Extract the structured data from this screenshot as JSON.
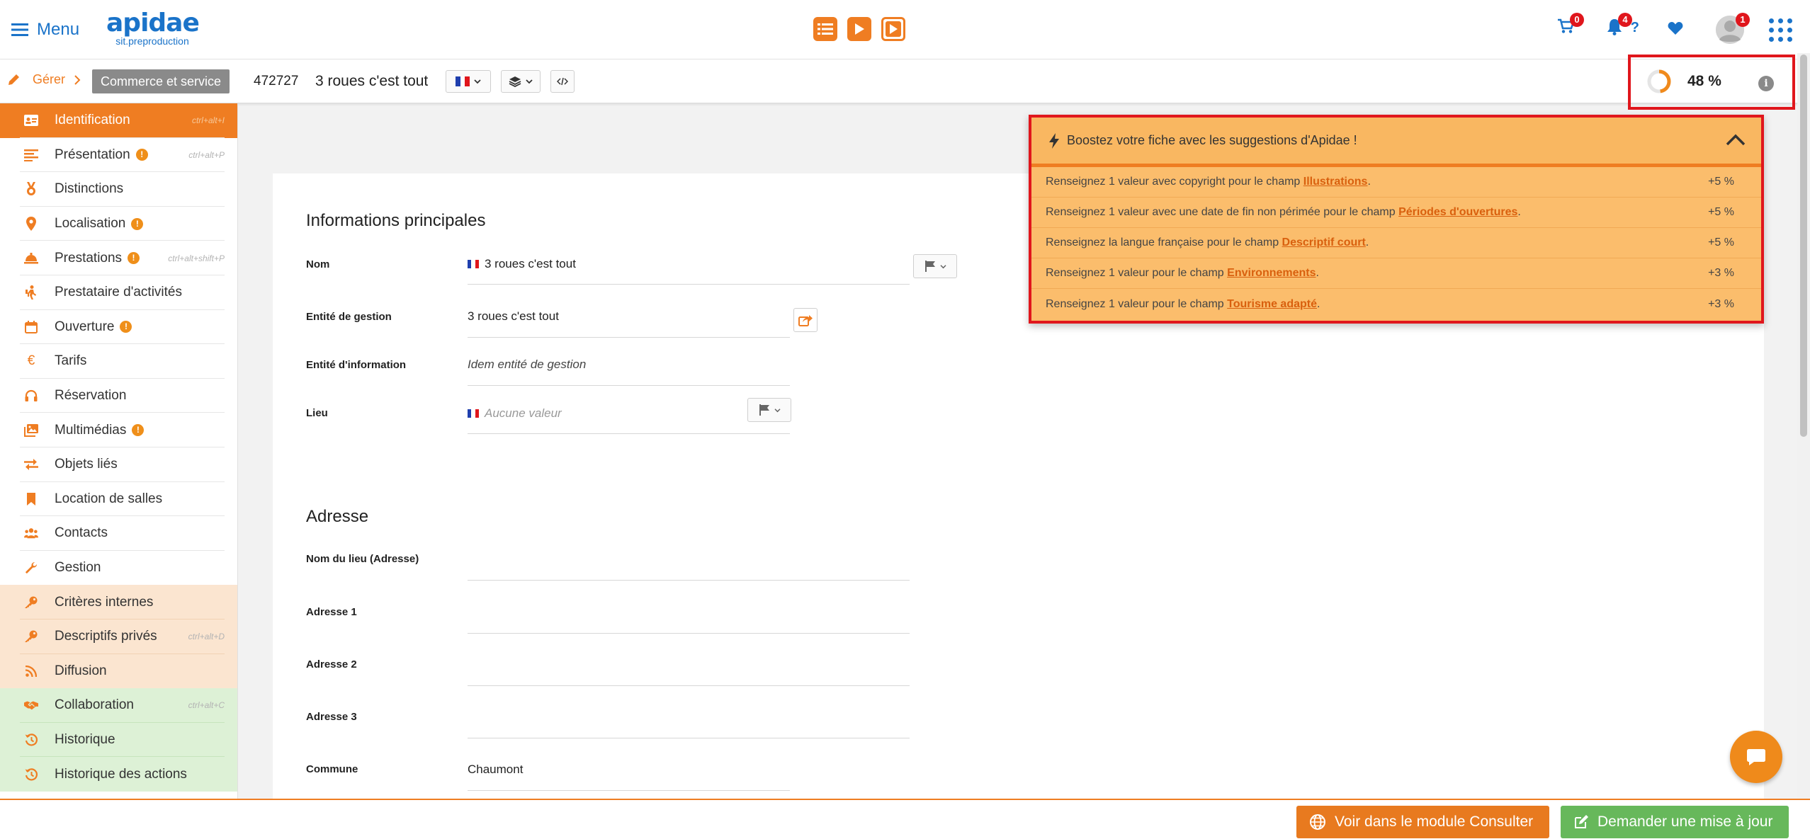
{
  "topbar": {
    "menu_label": "Menu",
    "logo_main": "apidae",
    "logo_sub": "sit.preproduction",
    "cart_count": "0",
    "notif_count": "4",
    "help_label": "?",
    "avatar_count": "1"
  },
  "breadcrumb": {
    "manage_label": "Gérer",
    "category": "Commerce et service",
    "object_id": "472727",
    "object_name": "3 roues c'est tout"
  },
  "score": {
    "value": 48,
    "label": "48 %"
  },
  "sidebar": {
    "items": [
      {
        "label": "Identification",
        "shortcut": "ctrl+alt+I"
      },
      {
        "label": "Présentation",
        "shortcut": "ctrl+alt+P",
        "warn": "!"
      },
      {
        "label": "Distinctions"
      },
      {
        "label": "Localisation",
        "warn": "!"
      },
      {
        "label": "Prestations",
        "shortcut": "ctrl+alt+shift+P",
        "warn": "!"
      },
      {
        "label": "Prestataire d'activités"
      },
      {
        "label": "Ouverture",
        "warn": "!"
      },
      {
        "label": "Tarifs"
      },
      {
        "label": "Réservation"
      },
      {
        "label": "Multimédias",
        "warn": "!"
      },
      {
        "label": "Objets liés"
      },
      {
        "label": "Location de salles"
      },
      {
        "label": "Contacts"
      },
      {
        "label": "Gestion"
      },
      {
        "label": "Critères internes"
      },
      {
        "label": "Descriptifs privés",
        "shortcut": "ctrl+alt+D"
      },
      {
        "label": "Diffusion"
      },
      {
        "label": "Collaboration",
        "shortcut": "ctrl+alt+C"
      },
      {
        "label": "Historique"
      },
      {
        "label": "Historique des actions"
      }
    ]
  },
  "form": {
    "main_title": "Informations principales",
    "nom_label": "Nom",
    "nom_value": "3 roues c'est tout",
    "entite_gestion_label": "Entité de gestion",
    "entite_gestion_value": "3 roues c'est tout",
    "entite_info_label": "Entité d'information",
    "entite_info_value": "Idem entité de gestion",
    "lieu_label": "Lieu",
    "lieu_placeholder": "Aucune valeur",
    "address_title": "Adresse",
    "nom_lieu_label": "Nom du lieu (Adresse)",
    "adresse1_label": "Adresse 1",
    "adresse2_label": "Adresse 2",
    "adresse3_label": "Adresse 3",
    "commune_label": "Commune",
    "commune_value": "Chaumont"
  },
  "suggestions": {
    "title": "Boostez votre fiche avec les suggestions d'Apidae !",
    "rows": [
      {
        "before": "Renseignez 1 valeur avec copyright pour le champ ",
        "link": "Illustrations",
        "after": ".",
        "points": "+5 %"
      },
      {
        "before": "Renseignez 1 valeur avec une date de fin non périmée pour le champ ",
        "link": "Périodes d'ouvertures",
        "after": ".",
        "points": "+5 %"
      },
      {
        "before": "Renseignez la langue française pour le champ ",
        "link": "Descriptif court",
        "after": ".",
        "points": "+5 %"
      },
      {
        "before": "Renseignez 1 valeur pour le champ ",
        "link": "Environnements",
        "after": ".",
        "points": "+3 %"
      },
      {
        "before": "Renseignez 1 valeur pour le champ ",
        "link": "Tourisme adapté",
        "after": ".",
        "points": "+3 %"
      }
    ]
  },
  "bottom": {
    "consult_label": "Voir dans le module Consulter",
    "update_label": "Demander une mise à jour"
  },
  "colors": {
    "accent": "#ef7d22",
    "brand_blue": "#1a73c9",
    "highlight_red": "#e0161c",
    "success": "#67b85b"
  }
}
